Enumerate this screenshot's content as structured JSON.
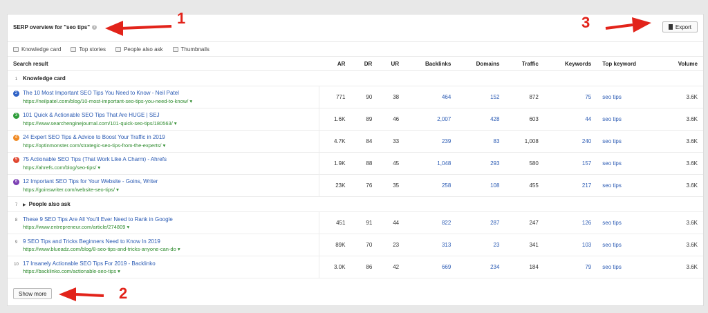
{
  "header": {
    "title": "SERP overview for \"seo tips\"",
    "export_label": "Export"
  },
  "filters": [
    {
      "label": "Knowledge card",
      "icon": "card-icon"
    },
    {
      "label": "Top stories",
      "icon": "stories-icon"
    },
    {
      "label": "People also ask",
      "icon": "question-icon"
    },
    {
      "label": "Thumbnails",
      "icon": "image-icon"
    }
  ],
  "columns": [
    "Search result",
    "AR",
    "DR",
    "UR",
    "Backlinks",
    "Domains",
    "Traffic",
    "Keywords",
    "Top keyword",
    "Volume"
  ],
  "sections": {
    "knowledge_card": {
      "pos": "1",
      "label": "Knowledge card"
    },
    "people_also_ask": {
      "pos": "7",
      "label": "People also ask"
    }
  },
  "rows": [
    {
      "pos": "2",
      "badge_color": "#2f62c6",
      "title": "The 10 Most Important SEO Tips You Need to Know - Neil Patel",
      "url": "https://neilpatel.com/blog/10-most-important-seo-tips-you-need-to-know/",
      "ar": "771",
      "dr": "90",
      "ur": "38",
      "backlinks": "464",
      "domains": "152",
      "traffic": "872",
      "keywords": "75",
      "top_keyword": "seo tips",
      "volume": "3.6K"
    },
    {
      "pos": "3",
      "badge_color": "#2e9d3a",
      "title": "101 Quick & Actionable SEO Tips That Are HUGE | SEJ",
      "url": "https://www.searchenginejournal.com/101-quick-seo-tips/180563/",
      "ar": "1.6K",
      "dr": "89",
      "ur": "46",
      "backlinks": "2,007",
      "domains": "428",
      "traffic": "603",
      "keywords": "44",
      "top_keyword": "seo tips",
      "volume": "3.6K"
    },
    {
      "pos": "4",
      "badge_color": "#f08a24",
      "title": "24 Expert SEO Tips & Advice to Boost Your Traffic in 2019",
      "url": "https://optinmonster.com/strategic-seo-tips-from-the-experts/",
      "ar": "4.7K",
      "dr": "84",
      "ur": "33",
      "backlinks": "239",
      "domains": "83",
      "traffic": "1,008",
      "keywords": "240",
      "top_keyword": "seo tips",
      "volume": "3.6K"
    },
    {
      "pos": "5",
      "badge_color": "#e0452e",
      "title": "75 Actionable SEO Tips (That Work Like A Charm) - Ahrefs",
      "url": "https://ahrefs.com/blog/seo-tips/",
      "ar": "1.9K",
      "dr": "88",
      "ur": "45",
      "backlinks": "1,048",
      "domains": "293",
      "traffic": "580",
      "keywords": "157",
      "top_keyword": "seo tips",
      "volume": "3.6K"
    },
    {
      "pos": "6",
      "badge_color": "#7b3fb3",
      "title": "12 Important SEO Tips for Your Website - Goins, Writer",
      "url": "https://goinswriter.com/website-seo-tips/",
      "ar": "23K",
      "dr": "76",
      "ur": "35",
      "backlinks": "258",
      "domains": "108",
      "traffic": "455",
      "keywords": "217",
      "top_keyword": "seo tips",
      "volume": "3.6K"
    }
  ],
  "rows2": [
    {
      "pos": "8",
      "title": "These 9 SEO Tips Are All You'll Ever Need to Rank in Google",
      "url": "https://www.entrepreneur.com/article/274809",
      "ar": "451",
      "dr": "91",
      "ur": "44",
      "backlinks": "822",
      "domains": "287",
      "traffic": "247",
      "keywords": "126",
      "top_keyword": "seo tips",
      "volume": "3.6K"
    },
    {
      "pos": "9",
      "title": "9 SEO Tips and Tricks Beginners Need to Know In 2019",
      "url": "https://www.blueadz.com/blog/8-seo-tips-and-tricks-anyone-can-do",
      "ar": "89K",
      "dr": "70",
      "ur": "23",
      "backlinks": "313",
      "domains": "23",
      "traffic": "341",
      "keywords": "103",
      "top_keyword": "seo tips",
      "volume": "3.6K"
    },
    {
      "pos": "10",
      "title": "17 Insanely Actionable SEO Tips For 2019 - Backlinko",
      "url": "https://backlinko.com/actionable-seo-tips",
      "ar": "3.0K",
      "dr": "86",
      "ur": "42",
      "backlinks": "669",
      "domains": "234",
      "traffic": "184",
      "keywords": "79",
      "top_keyword": "seo tips",
      "volume": "3.6K"
    }
  ],
  "footer": {
    "show_more_label": "Show more"
  },
  "annotations": {
    "one": "1",
    "two": "2",
    "three": "3",
    "color": "#e2231a"
  }
}
